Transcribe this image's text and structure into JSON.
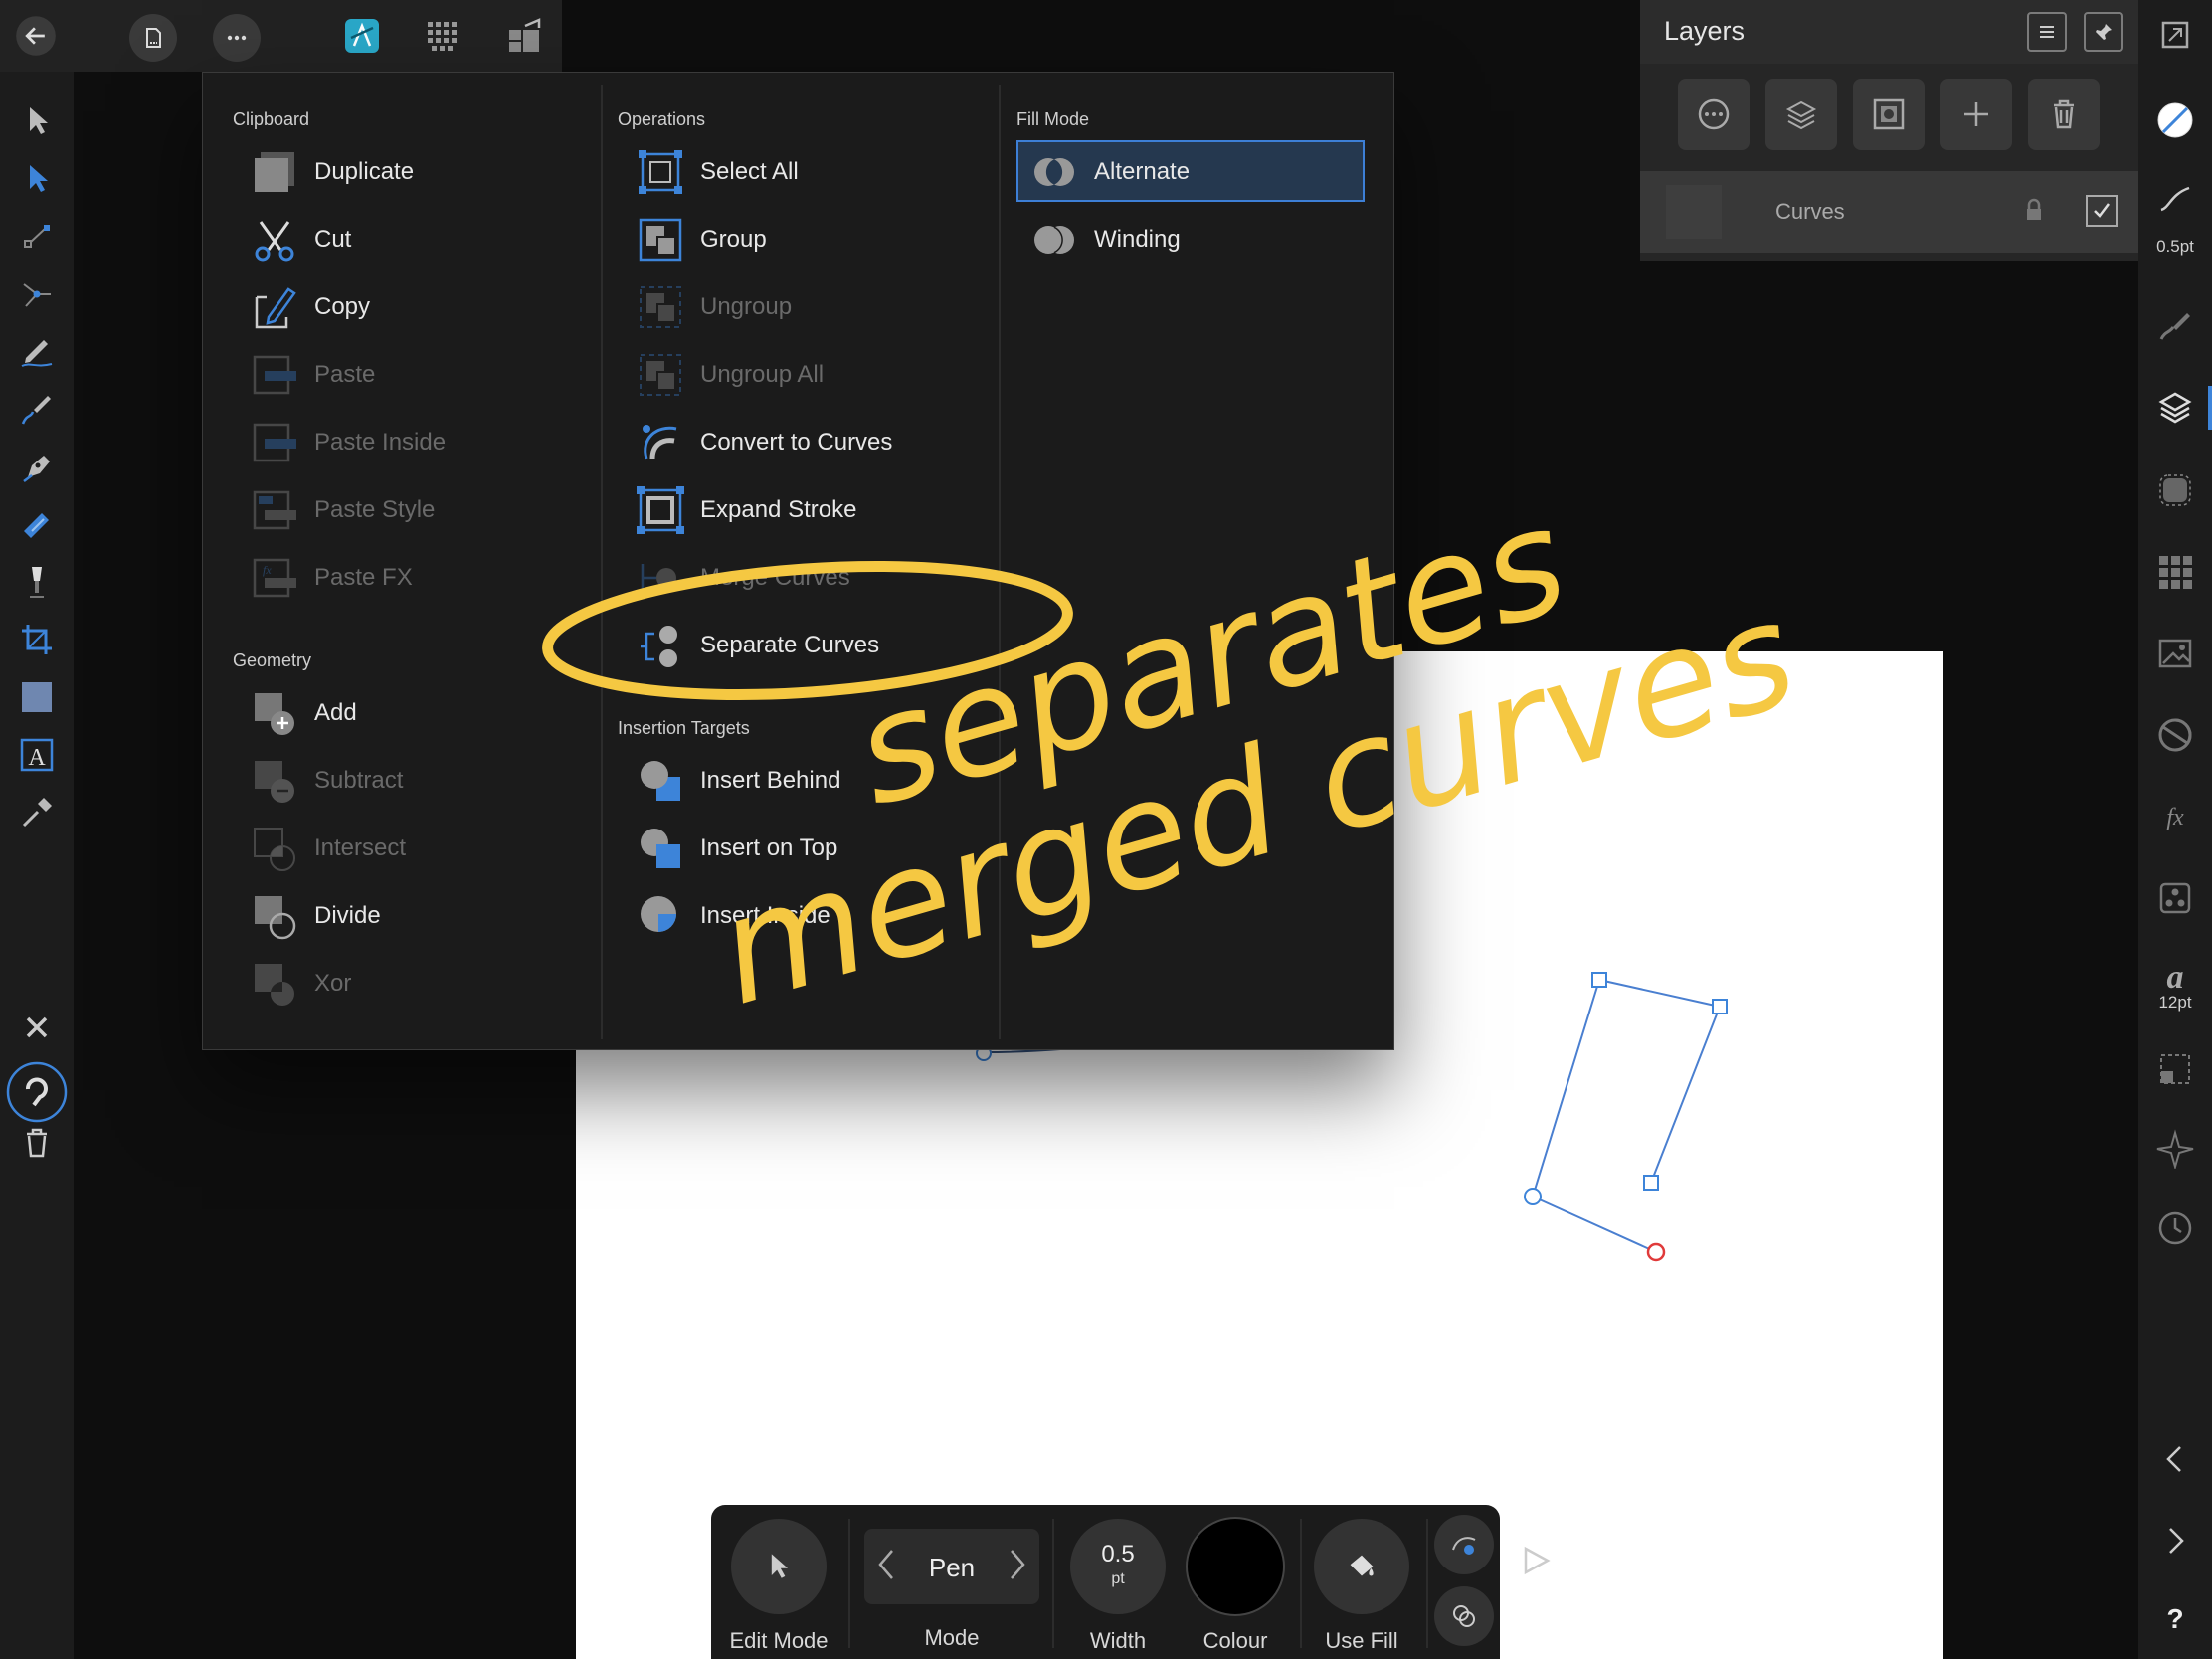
{
  "layers_panel": {
    "title": "Layers",
    "layer": {
      "name": "Curves"
    }
  },
  "right_toolbar": {
    "stroke_width_label": "0.5pt",
    "font_size_label": "12pt"
  },
  "menu": {
    "clipboard": {
      "title": "Clipboard",
      "items": [
        {
          "label": "Duplicate",
          "enabled": true
        },
        {
          "label": "Cut",
          "enabled": true
        },
        {
          "label": "Copy",
          "enabled": true
        },
        {
          "label": "Paste",
          "enabled": false
        },
        {
          "label": "Paste Inside",
          "enabled": false
        },
        {
          "label": "Paste Style",
          "enabled": false
        },
        {
          "label": "Paste FX",
          "enabled": false
        }
      ]
    },
    "geometry": {
      "title": "Geometry",
      "items": [
        {
          "label": "Add",
          "enabled": true
        },
        {
          "label": "Subtract",
          "enabled": false
        },
        {
          "label": "Intersect",
          "enabled": false
        },
        {
          "label": "Divide",
          "enabled": true
        },
        {
          "label": "Xor",
          "enabled": false
        }
      ]
    },
    "operations": {
      "title": "Operations",
      "items": [
        {
          "label": "Select All",
          "enabled": true
        },
        {
          "label": "Group",
          "enabled": true
        },
        {
          "label": "Ungroup",
          "enabled": false
        },
        {
          "label": "Ungroup All",
          "enabled": false
        },
        {
          "label": "Convert to Curves",
          "enabled": true
        },
        {
          "label": "Expand Stroke",
          "enabled": true
        },
        {
          "label": "Merge Curves",
          "enabled": false
        },
        {
          "label": "Separate Curves",
          "enabled": true
        }
      ]
    },
    "insertion_targets": {
      "title": "Insertion Targets",
      "items": [
        {
          "label": "Insert Behind",
          "enabled": true
        },
        {
          "label": "Insert on Top",
          "enabled": true
        },
        {
          "label": "Insert Inside",
          "enabled": true
        }
      ]
    },
    "fill_mode": {
      "title": "Fill Mode",
      "items": [
        {
          "label": "Alternate",
          "selected": true
        },
        {
          "label": "Winding",
          "selected": false
        }
      ]
    }
  },
  "bottom_toolbar": {
    "edit_mode_label": "Edit Mode",
    "mode_value": "Pen",
    "mode_label": "Mode",
    "width_value": "0.5",
    "width_unit": "pt",
    "width_label": "Width",
    "colour_label": "Colour",
    "colour_value": "#000000",
    "use_fill_label": "Use Fill"
  },
  "annotation": {
    "line1": "separates",
    "line2": "merged curves",
    "color": "#f5c842"
  },
  "colors": {
    "accent": "#3d7fd6",
    "menu_bg": "#1b1b1b",
    "panel_bg": "#1c1c1c"
  }
}
